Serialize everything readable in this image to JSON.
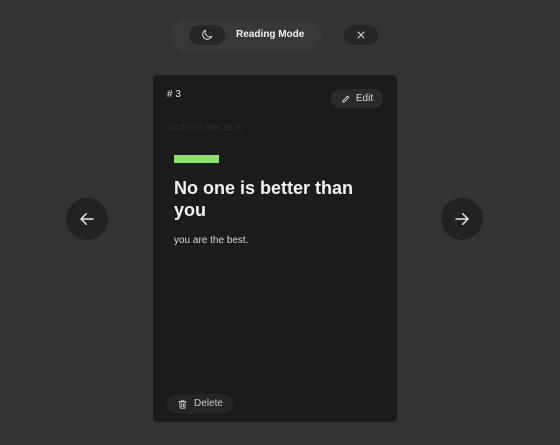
{
  "toolbar": {
    "mode_label": "Reading Mode",
    "moon_icon": "moon-icon",
    "close_icon": "close-icon"
  },
  "card": {
    "number": "# 3",
    "edit_label": "Edit",
    "date": "2023-2-13 Mon 18:30",
    "accent_color": "#8ee06d",
    "title": "No one is better than you",
    "body": "you are the best.",
    "delete_label": "Delete"
  },
  "navigation": {
    "prev_icon": "arrow-left-icon",
    "next_icon": "arrow-right-icon"
  },
  "colors": {
    "background": "#333333",
    "card": "#1b1b1b",
    "accent": "#8ee06d"
  }
}
